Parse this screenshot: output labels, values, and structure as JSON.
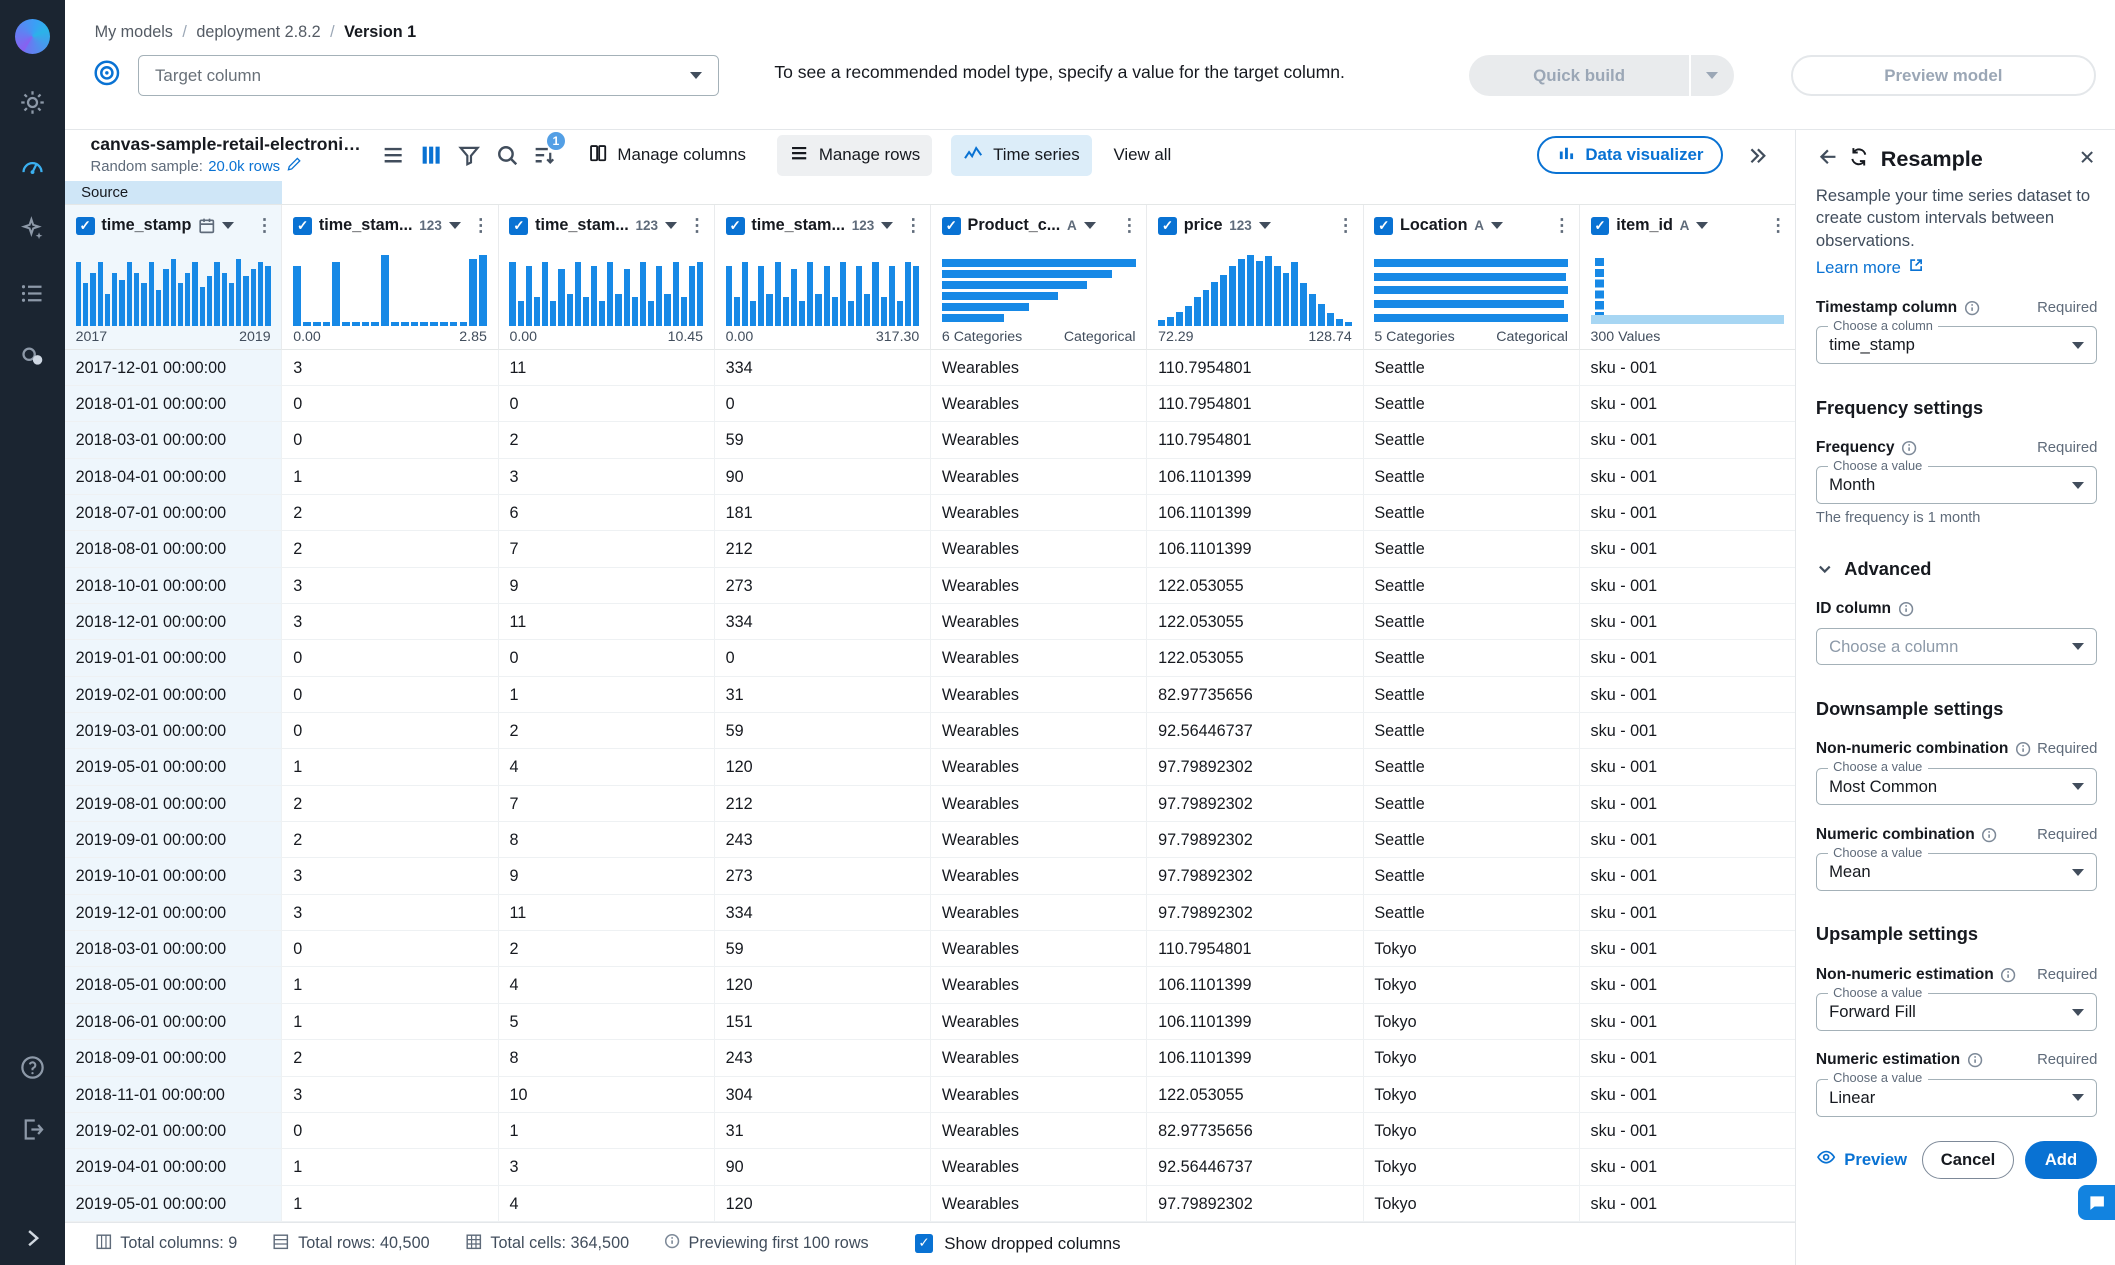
{
  "accent": "#0972d3",
  "histogram_color": "#1789e6",
  "breadcrumb": {
    "items": [
      "My models",
      "deployment 2.8.2",
      "Version 1"
    ]
  },
  "target_bar": {
    "dropdown_placeholder": "Target column",
    "hint": "To see a recommended model type, specify a value for the target column.",
    "quick_build_label": "Quick build",
    "preview_model_label": "Preview model"
  },
  "toolbar": {
    "dataset_name": "canvas-sample-retail-electronics-fore...",
    "random_sample_label": "Random sample:",
    "random_sample_value": "20.0k rows",
    "sort_badge": "1",
    "manage_columns_label": "Manage columns",
    "manage_rows_label": "Manage rows",
    "time_series_label": "Time series",
    "view_all_label": "View all",
    "data_visualizer_label": "Data visualizer"
  },
  "source_tab_label": "Source",
  "table": {
    "columns": [
      {
        "name": "time_stamp",
        "type_label": "date",
        "highlight": true,
        "hist": {
          "kind": "vbar",
          "values": [
            0.9,
            0.6,
            0.75,
            0.9,
            0.45,
            0.75,
            0.65,
            0.9,
            0.75,
            0.6,
            0.9,
            0.5,
            0.8,
            0.95,
            0.6,
            0.75,
            0.9,
            0.55,
            0.7,
            0.9,
            0.75,
            0.6,
            0.95,
            0.7,
            0.8,
            0.9,
            0.85
          ]
        },
        "range_left": "2017",
        "range_right": "2019"
      },
      {
        "name": "time_stam...",
        "type_label": "123",
        "hist": {
          "kind": "vbar",
          "values": [
            0.85,
            0.05,
            0.05,
            0.05,
            0.9,
            0.05,
            0.05,
            0.05,
            0.05,
            1,
            0.05,
            0.05,
            0.05,
            0.05,
            0.05,
            0.05,
            0.05,
            0.05,
            0.95,
            1
          ]
        },
        "range_left": "0.00",
        "range_right": "2.85"
      },
      {
        "name": "time_stam...",
        "type_label": "123",
        "hist": {
          "kind": "vbar",
          "values": [
            0.9,
            0.35,
            0.85,
            0.4,
            0.9,
            0.35,
            0.8,
            0.45,
            0.9,
            0.4,
            0.85,
            0.35,
            0.9,
            0.45,
            0.8,
            0.4,
            0.9,
            0.35,
            0.85,
            0.45,
            0.9,
            0.4,
            0.85,
            0.9
          ]
        },
        "range_left": "0.00",
        "range_right": "10.45"
      },
      {
        "name": "time_stam...",
        "type_label": "123",
        "hist": {
          "kind": "vbar",
          "values": [
            0.85,
            0.4,
            0.9,
            0.35,
            0.85,
            0.45,
            0.9,
            0.4,
            0.8,
            0.35,
            0.9,
            0.45,
            0.85,
            0.4,
            0.9,
            0.35,
            0.85,
            0.45,
            0.9,
            0.4,
            0.85,
            0.35,
            0.9,
            0.85
          ]
        },
        "range_left": "0.00",
        "range_right": "317.30"
      },
      {
        "name": "Product_c...",
        "type_label": "A",
        "hist": {
          "kind": "hbar",
          "values": [
            1,
            0.88,
            0.75,
            0.6,
            0.45,
            0.32
          ]
        },
        "range_left": "6 Categories",
        "range_right": "Categorical"
      },
      {
        "name": "price",
        "type_label": "123",
        "hist": {
          "kind": "vbar",
          "values": [
            0.08,
            0.12,
            0.2,
            0.28,
            0.4,
            0.5,
            0.62,
            0.72,
            0.85,
            0.95,
            1,
            0.92,
            0.98,
            0.85,
            0.75,
            0.9,
            0.6,
            0.45,
            0.3,
            0.18,
            0.1,
            0.05
          ]
        },
        "range_left": "72.29",
        "range_right": "128.74"
      },
      {
        "name": "Location",
        "type_label": "A",
        "hist": {
          "kind": "hbar",
          "values": [
            1,
            0.99,
            1,
            0.98,
            1
          ]
        },
        "range_left": "5 Categories",
        "range_right": "Categorical"
      },
      {
        "name": "item_id",
        "type_label": "A",
        "hist": {
          "kind": "unique"
        },
        "range_left": "300 Values",
        "range_right": ""
      }
    ],
    "rows": [
      [
        "2017-12-01 00:00:00",
        "3",
        "11",
        "334",
        "Wearables",
        "110.7954801",
        "Seattle",
        "sku - 001"
      ],
      [
        "2018-01-01 00:00:00",
        "0",
        "0",
        "0",
        "Wearables",
        "110.7954801",
        "Seattle",
        "sku - 001"
      ],
      [
        "2018-03-01 00:00:00",
        "0",
        "2",
        "59",
        "Wearables",
        "110.7954801",
        "Seattle",
        "sku - 001"
      ],
      [
        "2018-04-01 00:00:00",
        "1",
        "3",
        "90",
        "Wearables",
        "106.1101399",
        "Seattle",
        "sku - 001"
      ],
      [
        "2018-07-01 00:00:00",
        "2",
        "6",
        "181",
        "Wearables",
        "106.1101399",
        "Seattle",
        "sku - 001"
      ],
      [
        "2018-08-01 00:00:00",
        "2",
        "7",
        "212",
        "Wearables",
        "106.1101399",
        "Seattle",
        "sku - 001"
      ],
      [
        "2018-10-01 00:00:00",
        "3",
        "9",
        "273",
        "Wearables",
        "122.053055",
        "Seattle",
        "sku - 001"
      ],
      [
        "2018-12-01 00:00:00",
        "3",
        "11",
        "334",
        "Wearables",
        "122.053055",
        "Seattle",
        "sku - 001"
      ],
      [
        "2019-01-01 00:00:00",
        "0",
        "0",
        "0",
        "Wearables",
        "122.053055",
        "Seattle",
        "sku - 001"
      ],
      [
        "2019-02-01 00:00:00",
        "0",
        "1",
        "31",
        "Wearables",
        "82.97735656",
        "Seattle",
        "sku - 001"
      ],
      [
        "2019-03-01 00:00:00",
        "0",
        "2",
        "59",
        "Wearables",
        "92.56446737",
        "Seattle",
        "sku - 001"
      ],
      [
        "2019-05-01 00:00:00",
        "1",
        "4",
        "120",
        "Wearables",
        "97.79892302",
        "Seattle",
        "sku - 001"
      ],
      [
        "2019-08-01 00:00:00",
        "2",
        "7",
        "212",
        "Wearables",
        "97.79892302",
        "Seattle",
        "sku - 001"
      ],
      [
        "2019-09-01 00:00:00",
        "2",
        "8",
        "243",
        "Wearables",
        "97.79892302",
        "Seattle",
        "sku - 001"
      ],
      [
        "2019-10-01 00:00:00",
        "3",
        "9",
        "273",
        "Wearables",
        "97.79892302",
        "Seattle",
        "sku - 001"
      ],
      [
        "2019-12-01 00:00:00",
        "3",
        "11",
        "334",
        "Wearables",
        "97.79892302",
        "Seattle",
        "sku - 001"
      ],
      [
        "2018-03-01 00:00:00",
        "0",
        "2",
        "59",
        "Wearables",
        "110.7954801",
        "Tokyo",
        "sku - 001"
      ],
      [
        "2018-05-01 00:00:00",
        "1",
        "4",
        "120",
        "Wearables",
        "106.1101399",
        "Tokyo",
        "sku - 001"
      ],
      [
        "2018-06-01 00:00:00",
        "1",
        "5",
        "151",
        "Wearables",
        "106.1101399",
        "Tokyo",
        "sku - 001"
      ],
      [
        "2018-09-01 00:00:00",
        "2",
        "8",
        "243",
        "Wearables",
        "106.1101399",
        "Tokyo",
        "sku - 001"
      ],
      [
        "2018-11-01 00:00:00",
        "3",
        "10",
        "304",
        "Wearables",
        "122.053055",
        "Tokyo",
        "sku - 001"
      ],
      [
        "2019-02-01 00:00:00",
        "0",
        "1",
        "31",
        "Wearables",
        "82.97735656",
        "Tokyo",
        "sku - 001"
      ],
      [
        "2019-04-01 00:00:00",
        "1",
        "3",
        "90",
        "Wearables",
        "92.56446737",
        "Tokyo",
        "sku - 001"
      ],
      [
        "2019-05-01 00:00:00",
        "1",
        "4",
        "120",
        "Wearables",
        "97.79892302",
        "Tokyo",
        "sku - 001"
      ]
    ]
  },
  "panel": {
    "title": "Resample",
    "description": "Resample your time series dataset to create custom intervals between observations.",
    "learn_more_label": "Learn more",
    "required_label": "Required",
    "blocks": [
      {
        "kind": "field",
        "label": "Timestamp column",
        "info": true,
        "required": true,
        "float_label": "Choose a column",
        "value": "time_stamp"
      },
      {
        "kind": "heading",
        "text": "Frequency settings"
      },
      {
        "kind": "field",
        "label": "Frequency",
        "info": true,
        "required": true,
        "float_label": "Choose a value",
        "value": "Month",
        "helper": "The frequency is 1 month"
      },
      {
        "kind": "expander",
        "text": "Advanced"
      },
      {
        "kind": "field",
        "label": "ID column",
        "info": true,
        "required": false,
        "float_label": "",
        "value": "Choose a column",
        "placeholder": true
      },
      {
        "kind": "heading",
        "text": "Downsample settings"
      },
      {
        "kind": "field",
        "label": "Non-numeric combination",
        "info": true,
        "required": true,
        "float_label": "Choose a value",
        "value": "Most Common"
      },
      {
        "kind": "field",
        "label": "Numeric combination",
        "info": true,
        "required": true,
        "float_label": "Choose a value",
        "value": "Mean"
      },
      {
        "kind": "heading",
        "text": "Upsample settings"
      },
      {
        "kind": "field",
        "label": "Non-numeric estimation",
        "info": true,
        "required": true,
        "float_label": "Choose a value",
        "value": "Forward Fill"
      },
      {
        "kind": "field",
        "label": "Numeric estimation",
        "info": true,
        "required": true,
        "float_label": "Choose a value",
        "value": "Linear"
      }
    ],
    "footer": {
      "preview_label": "Preview",
      "cancel_label": "Cancel",
      "add_label": "Add"
    }
  },
  "status_bar": {
    "items": [
      {
        "icon": "total-columns-icon",
        "text": "Total columns: 9"
      },
      {
        "icon": "total-rows-icon",
        "text": "Total rows: 40,500"
      },
      {
        "icon": "total-cells-icon",
        "text": "Total cells: 364,500"
      },
      {
        "icon": "info-icon",
        "text": "Previewing first 100 rows"
      }
    ],
    "show_dropped_label": "Show dropped columns",
    "show_dropped_checked": true
  },
  "icons": {
    "sidebar": [
      "canvas-logo",
      "settings-gear",
      "models-gauge (active)",
      "genai-sparkle",
      "dataset-list",
      "circles",
      "help-question",
      "logout",
      "expand-chevron"
    ],
    "toolbar": [
      "list-view",
      "column-view (active)",
      "filter-funnel",
      "search-magnifier",
      "sort-with-badge",
      "manage-columns",
      "manage-rows",
      "time-series-line",
      "data-visualizer-bars",
      "double-chevron-right"
    ],
    "panel": [
      "back-arrow",
      "resample-refresh",
      "close-x",
      "info-circle",
      "external-link",
      "eye"
    ]
  }
}
